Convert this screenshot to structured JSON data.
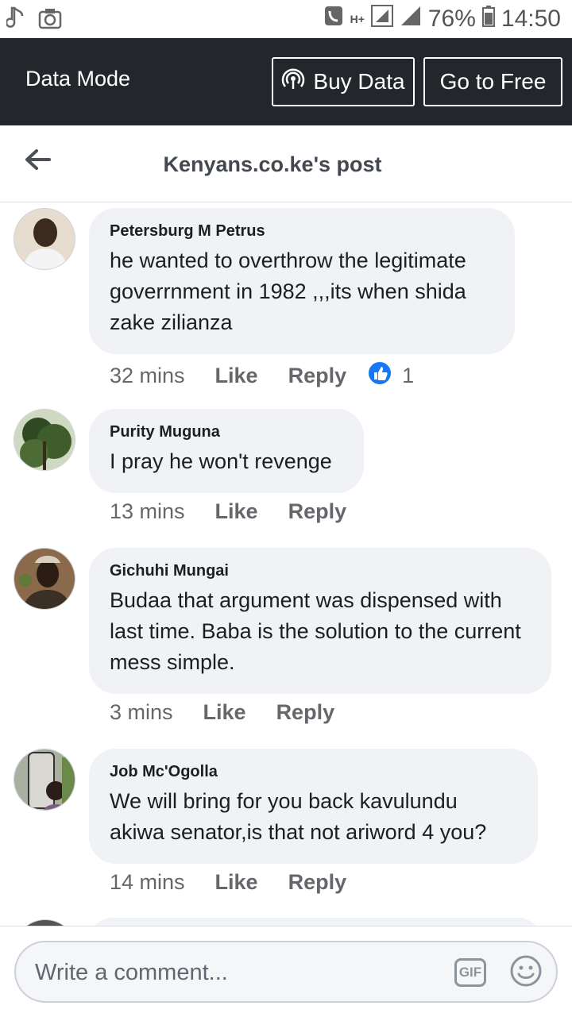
{
  "status_bar": {
    "battery_percent": "76%",
    "time": "14:50",
    "network": "H+"
  },
  "data_bar": {
    "label": "Data Mode",
    "buy_label": "Buy Data",
    "free_label": "Go to Free"
  },
  "header": {
    "title": "Kenyans.co.ke's post"
  },
  "comments": [
    {
      "name": "Petersburg M Petrus",
      "text": "he wanted to overthrow the legitimate goverrnment in 1982  ,,,its when shida zake zilianza",
      "time": "32 mins",
      "like": "Like",
      "reply": "Reply",
      "reaction_count": "1"
    },
    {
      "name": "Purity Muguna",
      "text": "I pray he won't revenge",
      "time": "13 mins",
      "like": "Like",
      "reply": "Reply"
    },
    {
      "name": "Gichuhi Mungai",
      "text": "Budaa that argument was dispensed with last time. Baba is the solution to the current mess simple.",
      "time": "3 mins",
      "like": "Like",
      "reply": "Reply"
    },
    {
      "name": "Job Mc'Ogolla",
      "text": "We will bring for you back  kavulundu akiwa senator,is that not ariword 4 you?",
      "time": "14 mins",
      "like": "Like",
      "reply": "Reply"
    }
  ],
  "composer": {
    "placeholder": "Write a comment...",
    "gif_label": "GIF"
  }
}
